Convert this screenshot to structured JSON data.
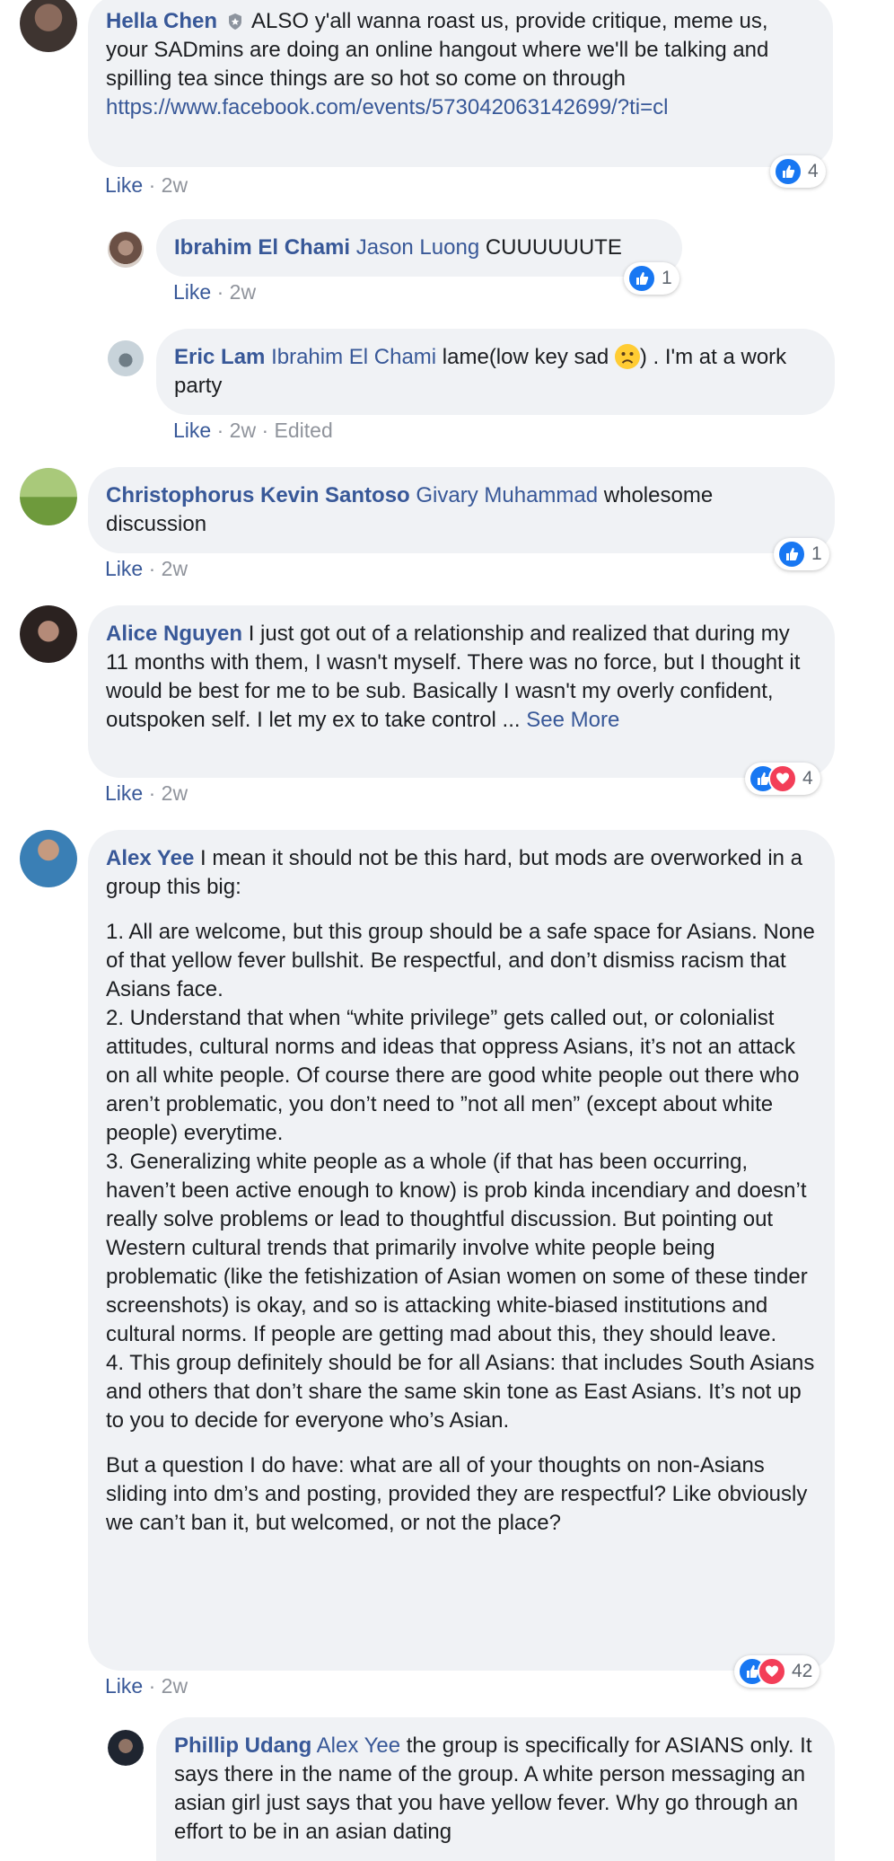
{
  "colors": {
    "link": "#385898",
    "bubble": "#f0f2f5",
    "meta": "#90949c",
    "like": "#1877f2",
    "love": "#f33e58"
  },
  "comments": [
    {
      "author": "Hella Chen",
      "badge": "admin-shield-icon",
      "text": " ALSO y'all wanna roast us, provide critique, meme us, your SADmins are doing an online hangout where we'll be talking and spilling tea since things are so hot so come on through ",
      "link": "https://www.facebook.com/events/573042063142699/?ti=cl",
      "like": "Like",
      "time": "2w",
      "reactions": "4"
    },
    {
      "author": "Ibrahim El Chami",
      "mention": "Jason Luong",
      "text": " CUUUUUUTE",
      "like": "Like",
      "time": "2w",
      "reactions": "1"
    },
    {
      "author": "Eric Lam",
      "mention": "Ibrahim El Chami",
      "text": " lame(low key sad ",
      "text_after": ") . I'm at a work party",
      "emoji": "sad-face-emoji",
      "like": "Like",
      "time": "2w",
      "edited": "Edited"
    },
    {
      "author": "Christophorus Kevin Santoso",
      "mention": "Givary Muhammad",
      "text": " wholesome discussion",
      "like": "Like",
      "time": "2w",
      "reactions": "1"
    },
    {
      "author": "Alice Nguyen",
      "text": " I just got out of a relationship and realized that during my 11 months with them, I wasn't myself. There was no force, but I thought it would be best for me to be sub. Basically I wasn't my overly confident, outspoken self. I let my ex to take control ... ",
      "see_more": "See More",
      "like": "Like",
      "time": "2w",
      "reactions": "4"
    },
    {
      "author": "Alex Yee",
      "text": " I mean it should not be this hard, but mods are overworked in a group this big:",
      "p1": "1. All are welcome, but this group should be a safe space for Asians. None of that yellow fever bullshit. Be respectful, and don’t dismiss racism that Asians face.",
      "p2": "2. Understand that when “white privilege” gets called out, or colonialist attitudes, cultural norms and ideas that oppress Asians, it’s not an attack on all white people. Of course there are good white people out there who aren’t problematic, you don’t need to ”not all men” (except about white people) everytime.",
      "p3": "3. Generalizing white people as a whole (if that has been occurring, haven’t been active enough to know) is prob kinda incendiary and doesn’t really solve problems or lead to thoughtful discussion. But pointing out Western cultural trends that primarily involve white people being problematic (like the fetishization of Asian women on some of these tinder screenshots) is okay, and so is attacking white-biased institutions and cultural norms. If people are getting mad about this, they should leave.",
      "p4": "4. This group definitely should be for all Asians: that includes South Asians and others that don’t share the same skin tone as East Asians. It’s not up to you to decide for everyone who’s Asian.",
      "p5": "But a question I do have: what are all of your thoughts on non-Asians sliding into dm’s and posting, provided they are respectful? Like obviously we can’t ban it, but welcomed, or not the place?",
      "like": "Like",
      "time": "2w",
      "reactions": "42"
    },
    {
      "author": "Phillip Udang",
      "mention": "Alex Yee",
      "text": " the group is specifically for ASIANS only. It says there in the name of the group. A white person messaging an asian girl just says that you have yellow fever. Why go through an effort to be in an asian dating"
    }
  ],
  "separator": " · "
}
